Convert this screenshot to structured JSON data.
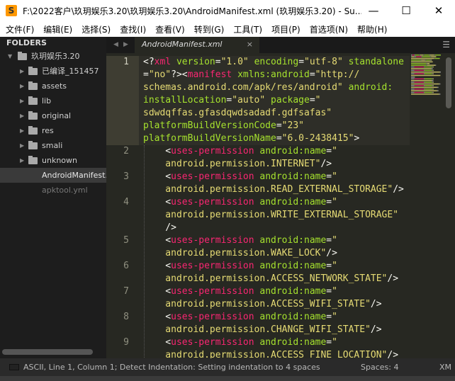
{
  "window": {
    "title": "F:\\2022客户\\玖玥娱乐3.20\\玖玥娱乐3.20\\AndroidManifest.xml (玖玥娱乐3.20) - Su...",
    "app_icon": "sublime-text-icon"
  },
  "menu": [
    "文件(F)",
    "编辑(E)",
    "选择(S)",
    "查找(I)",
    "查看(V)",
    "转到(G)",
    "工具(T)",
    "项目(P)",
    "首选项(N)",
    "帮助(H)"
  ],
  "sidebar": {
    "header": "FOLDERS",
    "root": "玖玥娱乐3.20",
    "folders": [
      "已编译_151457",
      "assets",
      "lib",
      "original",
      "res",
      "smali",
      "unknown"
    ],
    "files": [
      {
        "name": "AndroidManifest.xml",
        "selected": true
      },
      {
        "name": "apktool.yml",
        "selected": false
      }
    ]
  },
  "tab": {
    "label": "AndroidManifest.xml",
    "close": "×"
  },
  "colors": {
    "background": "#272822",
    "tag": "#f92672",
    "attribute": "#a6e22e",
    "string": "#e6db74"
  },
  "code": [
    {
      "n": "1",
      "rows": [
        [
          [
            "p",
            "<?"
          ],
          [
            "tag",
            "xml"
          ],
          [
            "p",
            " "
          ],
          [
            "attr",
            "version"
          ],
          [
            "p",
            "="
          ],
          [
            "str",
            "\"1.0\""
          ],
          [
            "p",
            " "
          ],
          [
            "attr",
            "encoding"
          ],
          [
            "p",
            "="
          ],
          [
            "str",
            "\"utf-8\""
          ],
          [
            "p",
            " "
          ],
          [
            "attr",
            "standalone"
          ]
        ],
        [
          [
            "p",
            "="
          ],
          [
            "str",
            "\"no\""
          ],
          [
            "p",
            "?><"
          ],
          [
            "tag",
            "manifest"
          ],
          [
            "p",
            " "
          ],
          [
            "attr",
            "xmlns:android"
          ],
          [
            "p",
            "="
          ],
          [
            "str",
            "\"http://"
          ]
        ],
        [
          [
            "str",
            "schemas.android.com/apk/res/android\""
          ],
          [
            "p",
            " "
          ],
          [
            "attr",
            "android:"
          ]
        ],
        [
          [
            "attr",
            "installLocation"
          ],
          [
            "p",
            "="
          ],
          [
            "str",
            "\"auto\""
          ],
          [
            "p",
            " "
          ],
          [
            "attr",
            "package"
          ],
          [
            "p",
            "="
          ],
          [
            "str",
            "\""
          ]
        ],
        [
          [
            "str",
            "sdwdqffas.gfasdqwdsadadf.gdfsafas\""
          ]
        ],
        [
          [
            "attr",
            "platformBuildVersionCode"
          ],
          [
            "p",
            "="
          ],
          [
            "str",
            "\"23\""
          ]
        ],
        [
          [
            "attr",
            "platformBuildVersionName"
          ],
          [
            "p",
            "="
          ],
          [
            "str",
            "\"6.0-2438415\""
          ],
          [
            "p",
            ">"
          ]
        ]
      ]
    },
    {
      "n": "2",
      "rows": [
        [
          [
            "p",
            "    <"
          ],
          [
            "tag",
            "uses-permission"
          ],
          [
            "p",
            " "
          ],
          [
            "attr",
            "android:name"
          ],
          [
            "p",
            "="
          ],
          [
            "str",
            "\""
          ]
        ],
        [
          [
            "str",
            "    android.permission.INTERNET\""
          ],
          [
            "p",
            "/>"
          ]
        ]
      ]
    },
    {
      "n": "3",
      "rows": [
        [
          [
            "p",
            "    <"
          ],
          [
            "tag",
            "uses-permission"
          ],
          [
            "p",
            " "
          ],
          [
            "attr",
            "android:name"
          ],
          [
            "p",
            "="
          ],
          [
            "str",
            "\""
          ]
        ],
        [
          [
            "str",
            "    android.permission.READ_EXTERNAL_STORAGE\""
          ],
          [
            "p",
            "/>"
          ]
        ]
      ]
    },
    {
      "n": "4",
      "rows": [
        [
          [
            "p",
            "    <"
          ],
          [
            "tag",
            "uses-permission"
          ],
          [
            "p",
            " "
          ],
          [
            "attr",
            "android:name"
          ],
          [
            "p",
            "="
          ],
          [
            "str",
            "\""
          ]
        ],
        [
          [
            "str",
            "    android.permission.WRITE_EXTERNAL_STORAGE\""
          ]
        ],
        [
          [
            "p",
            "    />"
          ]
        ]
      ]
    },
    {
      "n": "5",
      "rows": [
        [
          [
            "p",
            "    <"
          ],
          [
            "tag",
            "uses-permission"
          ],
          [
            "p",
            " "
          ],
          [
            "attr",
            "android:name"
          ],
          [
            "p",
            "="
          ],
          [
            "str",
            "\""
          ]
        ],
        [
          [
            "str",
            "    android.permission.WAKE_LOCK\""
          ],
          [
            "p",
            "/>"
          ]
        ]
      ]
    },
    {
      "n": "6",
      "rows": [
        [
          [
            "p",
            "    <"
          ],
          [
            "tag",
            "uses-permission"
          ],
          [
            "p",
            " "
          ],
          [
            "attr",
            "android:name"
          ],
          [
            "p",
            "="
          ],
          [
            "str",
            "\""
          ]
        ],
        [
          [
            "str",
            "    android.permission.ACCESS_NETWORK_STATE\""
          ],
          [
            "p",
            "/>"
          ]
        ]
      ]
    },
    {
      "n": "7",
      "rows": [
        [
          [
            "p",
            "    <"
          ],
          [
            "tag",
            "uses-permission"
          ],
          [
            "p",
            " "
          ],
          [
            "attr",
            "android:name"
          ],
          [
            "p",
            "="
          ],
          [
            "str",
            "\""
          ]
        ],
        [
          [
            "str",
            "    android.permission.ACCESS_WIFI_STATE\""
          ],
          [
            "p",
            "/>"
          ]
        ]
      ]
    },
    {
      "n": "8",
      "rows": [
        [
          [
            "p",
            "    <"
          ],
          [
            "tag",
            "uses-permission"
          ],
          [
            "p",
            " "
          ],
          [
            "attr",
            "android:name"
          ],
          [
            "p",
            "="
          ],
          [
            "str",
            "\""
          ]
        ],
        [
          [
            "str",
            "    android.permission.CHANGE_WIFI_STATE\""
          ],
          [
            "p",
            "/>"
          ]
        ]
      ]
    },
    {
      "n": "9",
      "rows": [
        [
          [
            "p",
            "    <"
          ],
          [
            "tag",
            "uses-permission"
          ],
          [
            "p",
            " "
          ],
          [
            "attr",
            "android:name"
          ],
          [
            "p",
            "="
          ],
          [
            "str",
            "\""
          ]
        ],
        [
          [
            "str",
            "    android.permission.ACCESS_FINE_LOCATION\""
          ],
          [
            "p",
            "/>"
          ]
        ]
      ]
    }
  ],
  "status": {
    "message": "ASCII, Line 1, Column 1; Detect Indentation: Setting indentation to 4 spaces",
    "spaces": "Spaces: 4",
    "syntax": "XM"
  }
}
